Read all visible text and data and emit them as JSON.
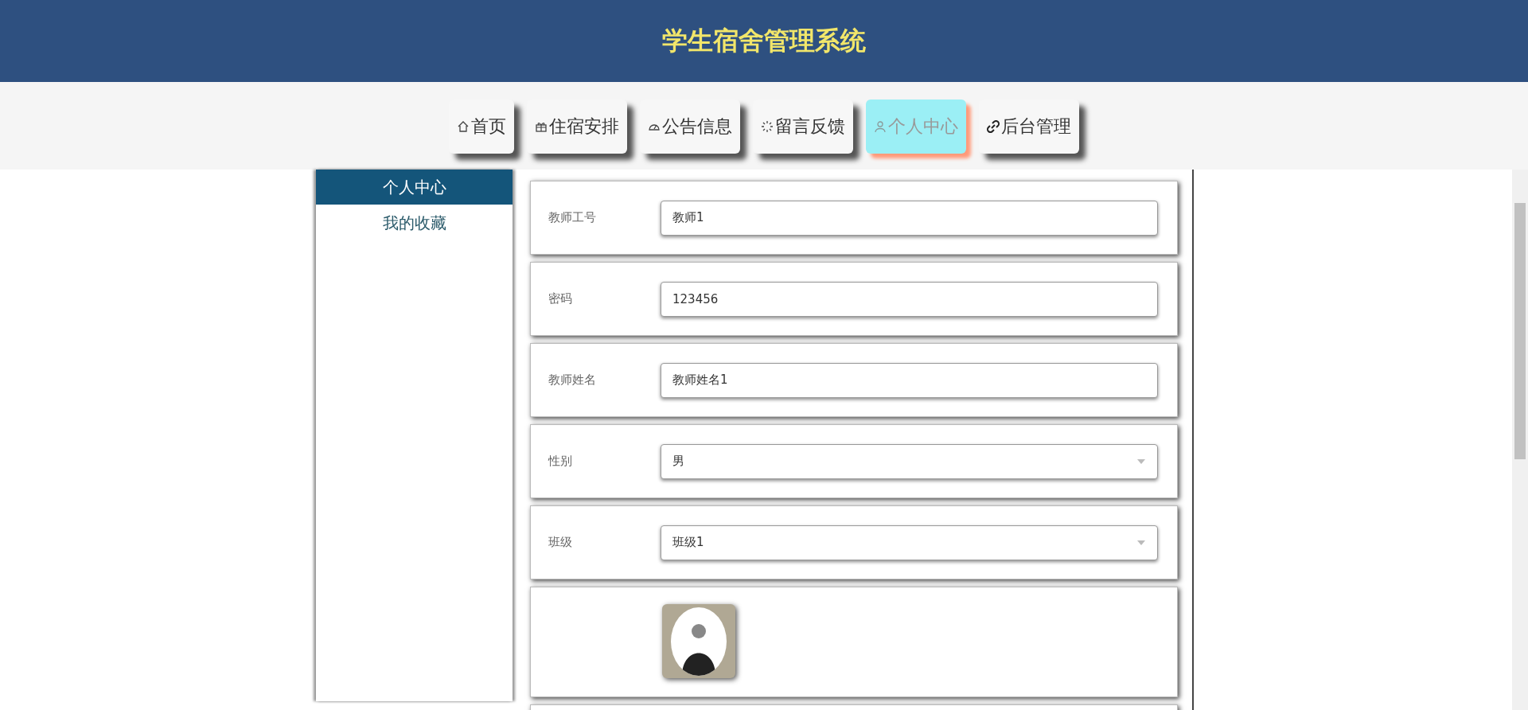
{
  "header": {
    "title": "学生宿舍管理系统"
  },
  "nav": [
    {
      "label": "首页",
      "selected": false
    },
    {
      "label": "住宿安排",
      "selected": false
    },
    {
      "label": "公告信息",
      "selected": false
    },
    {
      "label": "留言反馈",
      "selected": false
    },
    {
      "label": "个人中心",
      "selected": true
    },
    {
      "label": "后台管理",
      "selected": false
    }
  ],
  "sidebar": {
    "items": [
      {
        "label": "个人中心",
        "selected": true
      },
      {
        "label": "我的收藏",
        "selected": false
      }
    ]
  },
  "form": {
    "fields": [
      {
        "kind": "input",
        "label": "教师工号",
        "value": "教师1"
      },
      {
        "kind": "input",
        "label": "密码",
        "value": "123456"
      },
      {
        "kind": "input",
        "label": "教师姓名",
        "value": "教师姓名1"
      },
      {
        "kind": "select",
        "label": "性别",
        "value": "男"
      },
      {
        "kind": "select",
        "label": "班级",
        "value": "班级1"
      },
      {
        "kind": "photo"
      }
    ]
  }
}
